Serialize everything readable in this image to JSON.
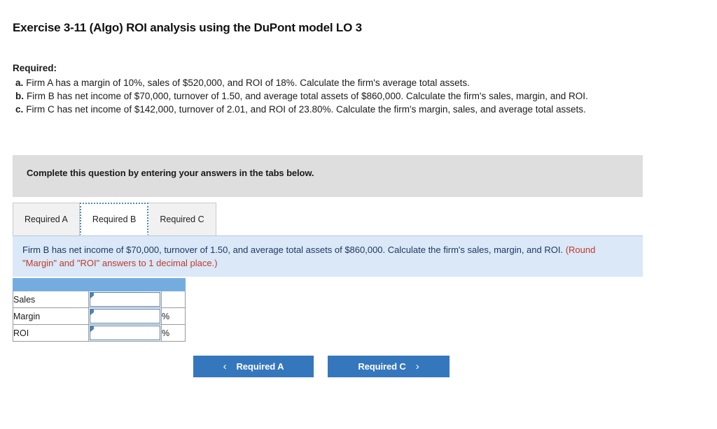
{
  "page_title": "Exercise 3-11 (Algo) ROI analysis using the DuPont model LO 3",
  "required": {
    "heading": "Required:",
    "items": [
      {
        "letter": "a.",
        "text": "Firm A has a margin of 10%, sales of $520,000, and ROI of 18%. Calculate the firm's average total assets."
      },
      {
        "letter": "b.",
        "text": "Firm B has net income of $70,000, turnover of 1.50, and average total assets of $860,000. Calculate the firm's sales, margin, and ROI."
      },
      {
        "letter": "c.",
        "text": "Firm C has net income of $142,000, turnover of 2.01, and ROI of 23.80%. Calculate the firm's margin, sales, and average total assets."
      }
    ]
  },
  "instruction_banner": {
    "text": "Complete this question by entering your answers in the tabs below."
  },
  "tabs": {
    "active": "Required B",
    "items": [
      {
        "label": "Required A",
        "active": false
      },
      {
        "label": "Required B",
        "active": true
      },
      {
        "label": "Required C",
        "active": false
      }
    ]
  },
  "info_box": {
    "text": "Firm B has net income of $70,000, turnover of 1.50, and average total assets of $860,000. Calculate the firm's sales, margin, and ROI.",
    "note": "(Round \"Margin\" and \"ROI\" answers to 1 decimal place.)"
  },
  "answer_table": {
    "header_cells": [
      "",
      "",
      ""
    ],
    "rows": [
      {
        "label": "Sales",
        "value": "",
        "unit": ""
      },
      {
        "label": "Margin",
        "value": "",
        "unit": "%"
      },
      {
        "label": "ROI",
        "value": "",
        "unit": "%"
      }
    ]
  },
  "nav": {
    "prev_label": "Required A",
    "prev_icon": "chevron-left-icon",
    "prev_glyph": "‹",
    "next_label": "Required C",
    "next_icon": "chevron-right-icon",
    "next_glyph": "›"
  },
  "colors": {
    "button_blue": "#3577bc",
    "table_header_blue": "#74ace0",
    "info_box_bg": "#dae8f7",
    "info_text_navy": "#1f3864",
    "note_red": "#c0392b",
    "banner_gray": "#dedede",
    "input_border_blue": "#4e81b8",
    "tab_focus_blue": "#4a86c8"
  }
}
